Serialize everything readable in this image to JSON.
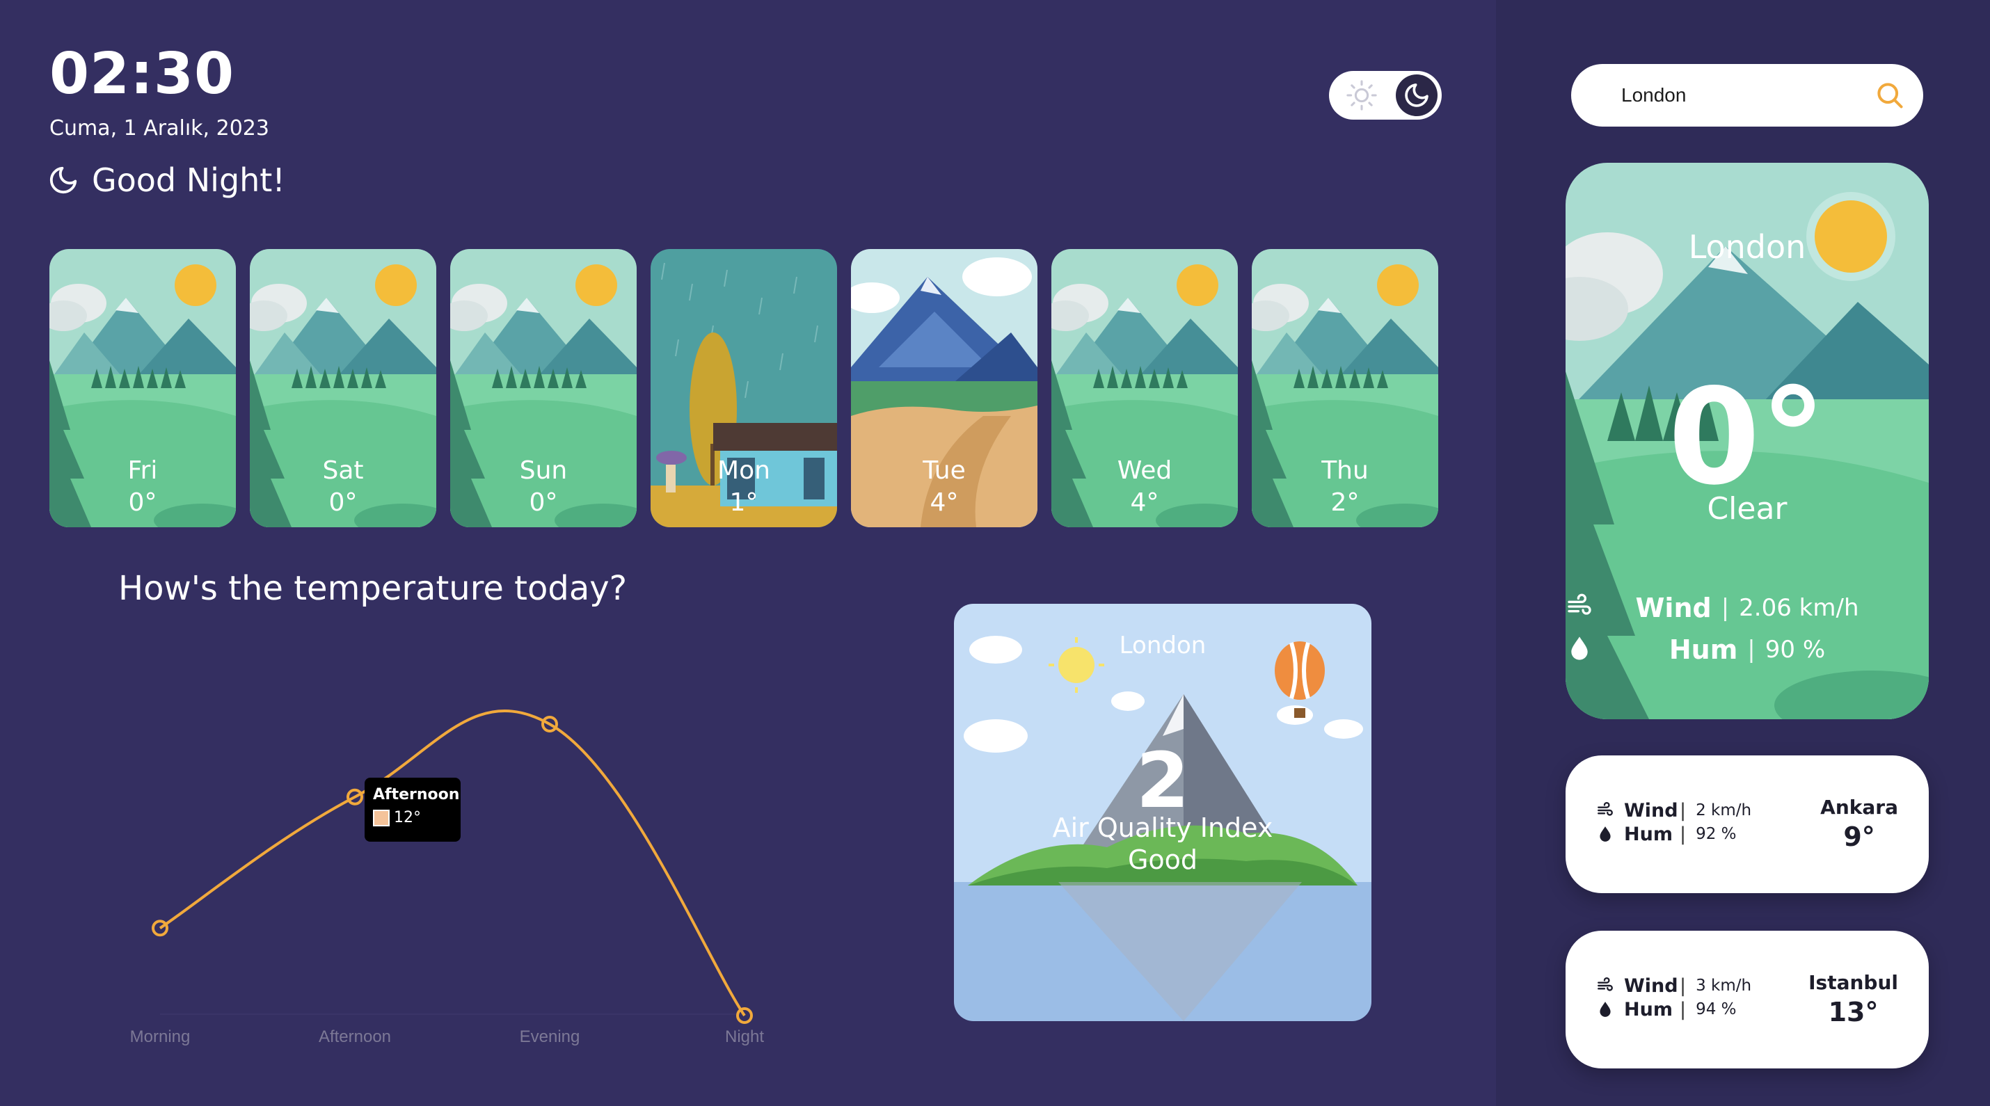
{
  "header": {
    "time": "02:30",
    "date": "Cuma, 1 Aralık, 2023",
    "greeting": "Good Night!"
  },
  "theme_toggle": {
    "mode": "dark"
  },
  "forecast": [
    {
      "day": "Fri",
      "temp": "0°",
      "scene": "sunny"
    },
    {
      "day": "Sat",
      "temp": "0°",
      "scene": "sunny"
    },
    {
      "day": "Sun",
      "temp": "0°",
      "scene": "sunny"
    },
    {
      "day": "Mon",
      "temp": "1°",
      "scene": "rain"
    },
    {
      "day": "Tue",
      "temp": "4°",
      "scene": "cloudy"
    },
    {
      "day": "Wed",
      "temp": "4°",
      "scene": "sunny"
    },
    {
      "day": "Thu",
      "temp": "2°",
      "scene": "sunny"
    }
  ],
  "chart_section": {
    "title": "How's the temperature today?"
  },
  "chart_data": {
    "type": "line",
    "categories": [
      "Morning",
      "Afternoon",
      "Evening",
      "Night"
    ],
    "values": [
      3,
      12,
      17,
      -3
    ],
    "ylim": [
      -3,
      18
    ],
    "color": "#f1a93c",
    "grid": false,
    "tooltip": {
      "title": "Afternoon",
      "value": "12°"
    }
  },
  "air_quality": {
    "city": "London",
    "index": "2",
    "label": "Air Quality Index",
    "status": "Good"
  },
  "search": {
    "value": "London"
  },
  "current": {
    "city": "London",
    "temp": "0°",
    "condition": "Clear",
    "wind_label": "Wind",
    "wind": "2.06 km/h",
    "hum_label": "Hum",
    "hum": "90 %"
  },
  "other_cities": [
    {
      "wind_label": "Wind",
      "wind": "2 km/h",
      "hum_label": "Hum",
      "hum": "92 %",
      "city": "Ankara",
      "temp": "9°"
    },
    {
      "wind_label": "Wind",
      "wind": "3 km/h",
      "hum_label": "Hum",
      "hum": "94 %",
      "city": "Istanbul",
      "temp": "13°"
    }
  ],
  "colors": {
    "background": "#342f61",
    "sidebar": "#2f2b58",
    "accent": "#f1a93c",
    "card_white": "#ffffff"
  }
}
